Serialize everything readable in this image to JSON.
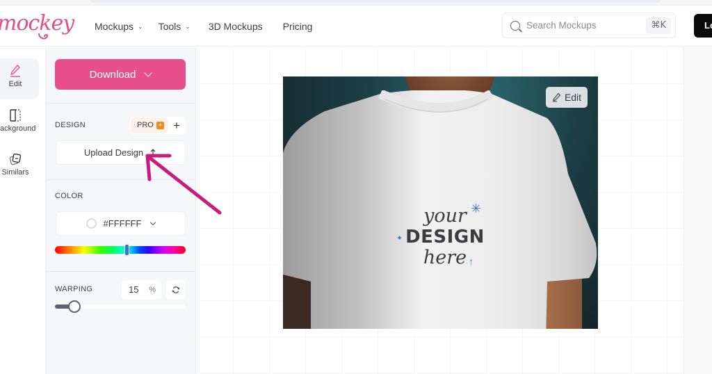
{
  "app": {
    "logo_text": "mockey",
    "brand_color": "#e8508b"
  },
  "nav": {
    "items": [
      {
        "label": "Mockups",
        "has_dropdown": true
      },
      {
        "label": "Tools",
        "has_dropdown": true
      },
      {
        "label": "3D Mockups",
        "has_dropdown": false
      },
      {
        "label": "Pricing",
        "has_dropdown": false
      }
    ]
  },
  "search": {
    "placeholder": "Search Mockups",
    "shortcut": "⌘K",
    "icon": "search-icon"
  },
  "login": {
    "label": "Lo"
  },
  "rail": {
    "items": [
      {
        "label": "Edit",
        "icon": "pencil-icon",
        "active": true
      },
      {
        "label": "Background",
        "icon": "background-icon",
        "active": false
      },
      {
        "label": "Similars",
        "icon": "similars-icon",
        "active": false
      }
    ]
  },
  "panel": {
    "download_label": "Download",
    "design": {
      "label": "DESIGN",
      "badge": "PRO",
      "add_icon": "plus-icon",
      "upload_label": "Upload Design"
    },
    "color": {
      "label": "COLOR",
      "value": "#FFFFFF",
      "hue_position_pct": 55
    },
    "warping": {
      "label": "WARPING",
      "value": "15",
      "unit": "%",
      "slider_pct": 15
    }
  },
  "mockup": {
    "edit_label": "Edit",
    "design_lines": [
      "your",
      "DESIGN",
      "here"
    ]
  },
  "colors": {
    "accent": "#e8508b",
    "annotation_arrow": "#c81d7a",
    "sparkle": "#3a78c9"
  }
}
